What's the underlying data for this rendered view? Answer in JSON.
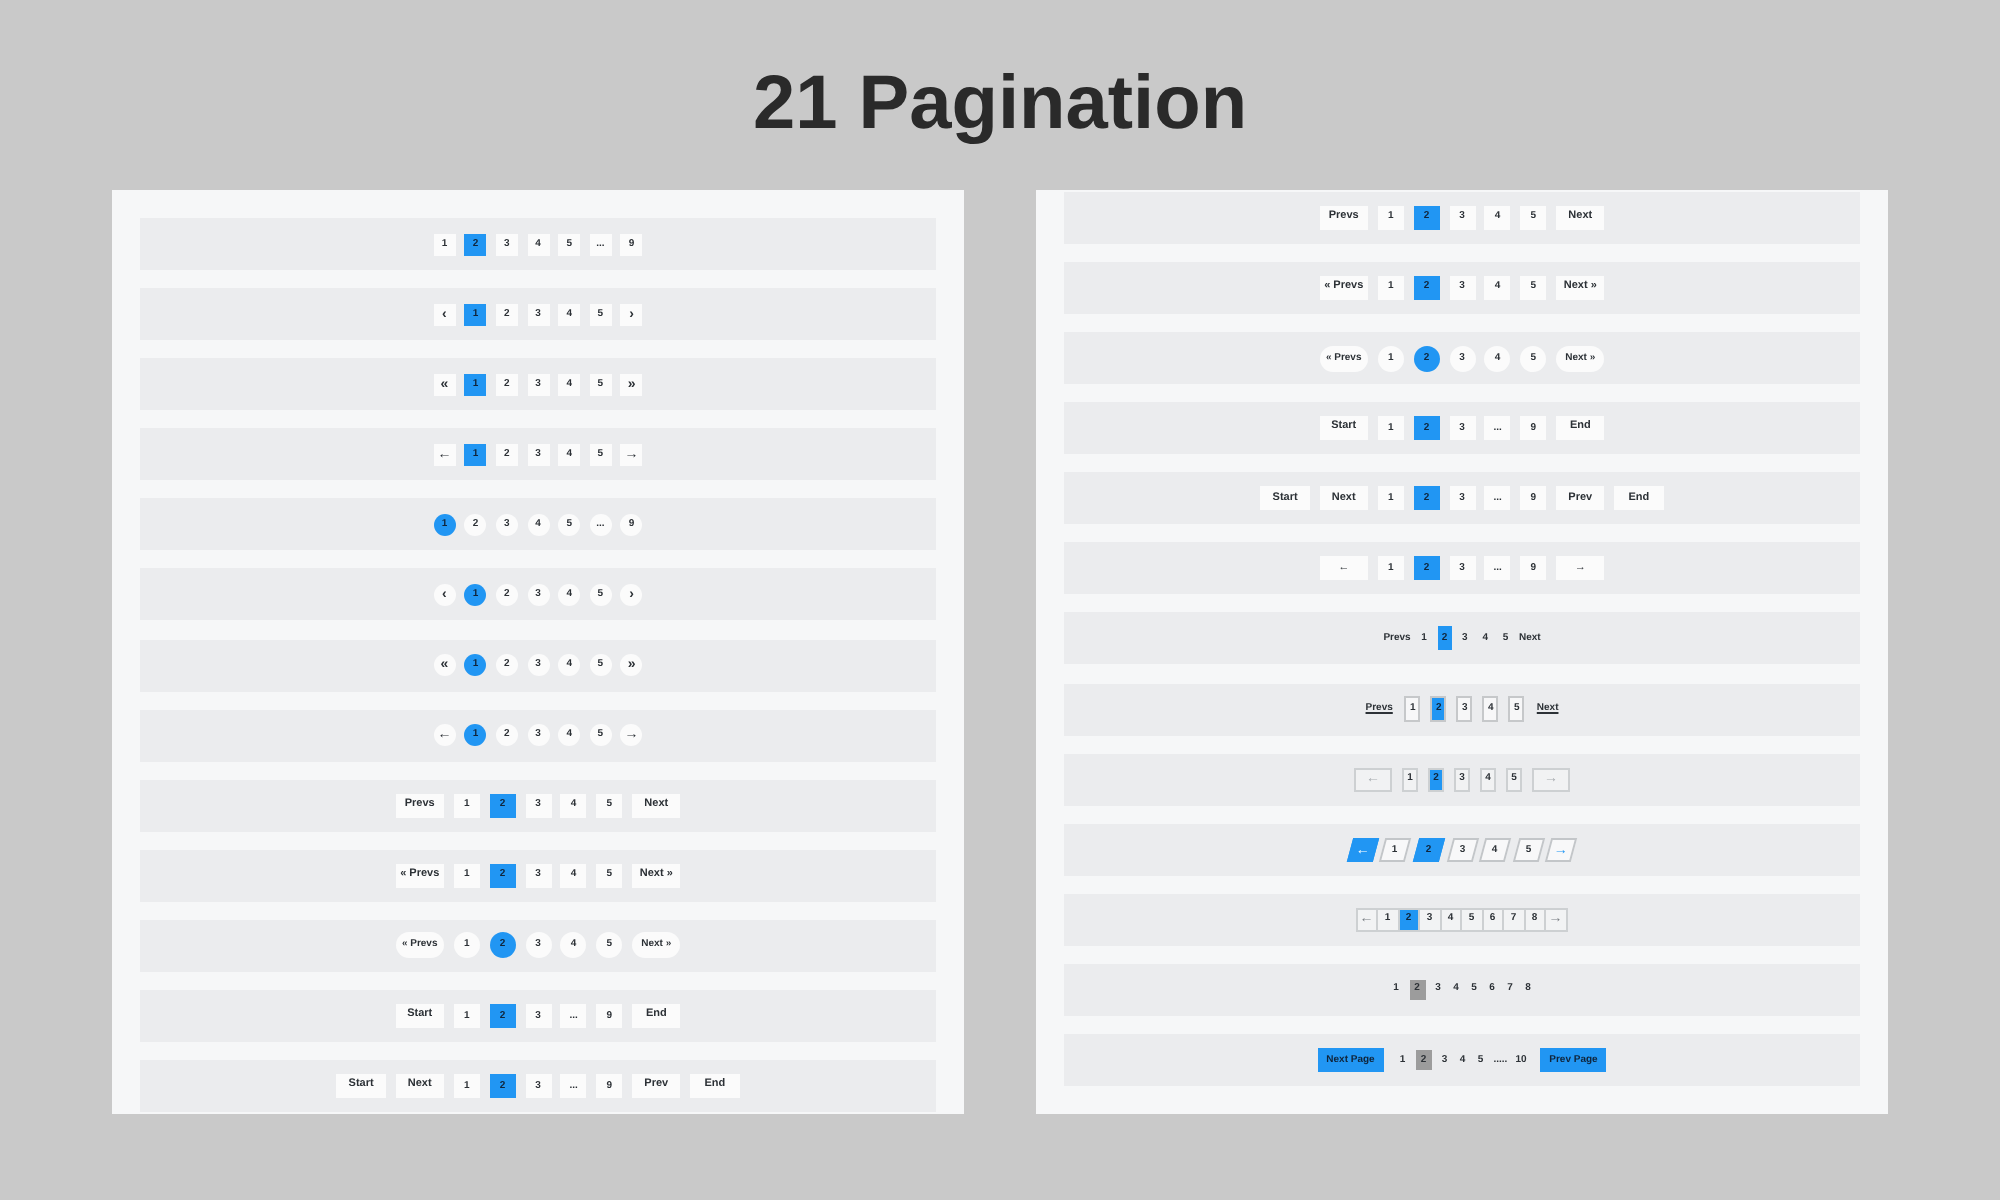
{
  "title": "21 Pagination",
  "panels": [
    {
      "rows": [
        {
          "kind": "mini",
          "items": [
            {
              "kind": "page",
              "text": "1",
              "selected": false
            },
            {
              "kind": "page",
              "text": "2",
              "selected": true
            },
            {
              "kind": "page",
              "text": "3",
              "selected": false
            },
            {
              "kind": "page",
              "text": "4",
              "selected": false
            },
            {
              "kind": "page",
              "text": "5",
              "selected": false
            },
            {
              "kind": "gap",
              "text": "...",
              "selected": false
            },
            {
              "kind": "page",
              "text": "9",
              "selected": false
            }
          ]
        },
        {
          "kind": "mini",
          "items": [
            {
              "kind": "nav",
              "text": "‹",
              "selected": false
            },
            {
              "kind": "page",
              "text": "1",
              "selected": true
            },
            {
              "kind": "page",
              "text": "2",
              "selected": false
            },
            {
              "kind": "page",
              "text": "3",
              "selected": false
            },
            {
              "kind": "page",
              "text": "4",
              "selected": false
            },
            {
              "kind": "page",
              "text": "5",
              "selected": false
            },
            {
              "kind": "nav",
              "text": "›",
              "selected": false
            }
          ]
        },
        {
          "kind": "mini",
          "items": [
            {
              "kind": "nav",
              "text": "«",
              "selected": false
            },
            {
              "kind": "page",
              "text": "1",
              "selected": true
            },
            {
              "kind": "page",
              "text": "2",
              "selected": false
            },
            {
              "kind": "page",
              "text": "3",
              "selected": false
            },
            {
              "kind": "page",
              "text": "4",
              "selected": false
            },
            {
              "kind": "page",
              "text": "5",
              "selected": false
            },
            {
              "kind": "nav",
              "text": "»",
              "selected": false
            }
          ]
        },
        {
          "kind": "mini",
          "items": [
            {
              "kind": "nav",
              "text": "←",
              "selected": false
            },
            {
              "kind": "page",
              "text": "1",
              "selected": true
            },
            {
              "kind": "page",
              "text": "2",
              "selected": false
            },
            {
              "kind": "page",
              "text": "3",
              "selected": false
            },
            {
              "kind": "page",
              "text": "4",
              "selected": false
            },
            {
              "kind": "page",
              "text": "5",
              "selected": false
            },
            {
              "kind": "nav",
              "text": "→",
              "selected": false
            }
          ]
        },
        {
          "kind": "dots",
          "items": [
            {
              "kind": "page",
              "text": "1",
              "selected": true
            },
            {
              "kind": "page",
              "text": "2",
              "selected": false
            },
            {
              "kind": "page",
              "text": "3",
              "selected": false
            },
            {
              "kind": "page",
              "text": "4",
              "selected": false
            },
            {
              "kind": "page",
              "text": "5",
              "selected": false
            },
            {
              "kind": "gap",
              "text": "...",
              "selected": false
            },
            {
              "kind": "page",
              "text": "9",
              "selected": false
            }
          ]
        },
        {
          "kind": "dots",
          "items": [
            {
              "kind": "nav",
              "text": "‹",
              "selected": false
            },
            {
              "kind": "page",
              "text": "1",
              "selected": true
            },
            {
              "kind": "page",
              "text": "2",
              "selected": false
            },
            {
              "kind": "page",
              "text": "3",
              "selected": false
            },
            {
              "kind": "page",
              "text": "4",
              "selected": false
            },
            {
              "kind": "page",
              "text": "5",
              "selected": false
            },
            {
              "kind": "nav",
              "text": "›",
              "selected": false
            }
          ]
        },
        {
          "kind": "dots",
          "items": [
            {
              "kind": "nav",
              "text": "«",
              "selected": false
            },
            {
              "kind": "page",
              "text": "1",
              "selected": true
            },
            {
              "kind": "page",
              "text": "2",
              "selected": false
            },
            {
              "kind": "page",
              "text": "3",
              "selected": false
            },
            {
              "kind": "page",
              "text": "4",
              "selected": false
            },
            {
              "kind": "page",
              "text": "5",
              "selected": false
            },
            {
              "kind": "nav",
              "text": "»",
              "selected": false
            }
          ]
        },
        {
          "kind": "dots",
          "items": [
            {
              "kind": "nav",
              "text": "←",
              "selected": false
            },
            {
              "kind": "page",
              "text": "1",
              "selected": true
            },
            {
              "kind": "page",
              "text": "2",
              "selected": false
            },
            {
              "kind": "page",
              "text": "3",
              "selected": false
            },
            {
              "kind": "page",
              "text": "4",
              "selected": false
            },
            {
              "kind": "page",
              "text": "5",
              "selected": false
            },
            {
              "kind": "nav",
              "text": "→",
              "selected": false
            }
          ]
        },
        {
          "kind": "box",
          "items": [
            {
              "kind": "nav",
              "text": "Prevs",
              "selected": false
            },
            {
              "kind": "page",
              "text": "1",
              "selected": false
            },
            {
              "kind": "page",
              "text": "2",
              "selected": true
            },
            {
              "kind": "page",
              "text": "3",
              "selected": false
            },
            {
              "kind": "page",
              "text": "4",
              "selected": false
            },
            {
              "kind": "page",
              "text": "5",
              "selected": false
            },
            {
              "kind": "nav",
              "text": "Next",
              "selected": false
            }
          ]
        },
        {
          "kind": "box",
          "items": [
            {
              "kind": "nav",
              "text": "« Prevs",
              "selected": false
            },
            {
              "kind": "page",
              "text": "1",
              "selected": false
            },
            {
              "kind": "page",
              "text": "2",
              "selected": true
            },
            {
              "kind": "page",
              "text": "3",
              "selected": false
            },
            {
              "kind": "page",
              "text": "4",
              "selected": false
            },
            {
              "kind": "page",
              "text": "5",
              "selected": false
            },
            {
              "kind": "nav",
              "text": "Next »",
              "selected": false
            }
          ]
        },
        {
          "kind": "round",
          "items": [
            {
              "kind": "nav",
              "text": "« Prevs",
              "selected": false
            },
            {
              "kind": "page",
              "text": "1",
              "selected": false
            },
            {
              "kind": "page",
              "text": "2",
              "selected": true
            },
            {
              "kind": "page",
              "text": "3",
              "selected": false
            },
            {
              "kind": "page",
              "text": "4",
              "selected": false
            },
            {
              "kind": "page",
              "text": "5",
              "selected": false
            },
            {
              "kind": "nav",
              "text": "Next »",
              "selected": false
            }
          ]
        },
        {
          "kind": "box",
          "items": [
            {
              "kind": "nav",
              "text": "Start",
              "selected": false
            },
            {
              "kind": "page",
              "text": "1",
              "selected": false
            },
            {
              "kind": "page",
              "text": "2",
              "selected": true
            },
            {
              "kind": "page",
              "text": "3",
              "selected": false
            },
            {
              "kind": "gap",
              "text": "...",
              "selected": false
            },
            {
              "kind": "page",
              "text": "9",
              "selected": false
            },
            {
              "kind": "nav",
              "text": "End",
              "selected": false
            }
          ]
        },
        {
          "kind": "box",
          "items": [
            {
              "kind": "nav",
              "text": "Start",
              "selected": false
            },
            {
              "kind": "nav",
              "text": "Next",
              "selected": false
            },
            {
              "kind": "page",
              "text": "1",
              "selected": false
            },
            {
              "kind": "page",
              "text": "2",
              "selected": true
            },
            {
              "kind": "page",
              "text": "3",
              "selected": false
            },
            {
              "kind": "gap",
              "text": "...",
              "selected": false
            },
            {
              "kind": "page",
              "text": "9",
              "selected": false
            },
            {
              "kind": "nav",
              "text": "Prev",
              "selected": false
            },
            {
              "kind": "nav",
              "text": "End",
              "selected": false
            }
          ]
        }
      ]
    },
    {
      "rows": [
        {
          "kind": "box",
          "items": [
            {
              "kind": "nav",
              "text": "Prevs",
              "selected": false
            },
            {
              "kind": "page",
              "text": "1",
              "selected": false
            },
            {
              "kind": "page",
              "text": "2",
              "selected": true
            },
            {
              "kind": "page",
              "text": "3",
              "selected": false
            },
            {
              "kind": "page",
              "text": "4",
              "selected": false
            },
            {
              "kind": "page",
              "text": "5",
              "selected": false
            },
            {
              "kind": "nav",
              "text": "Next",
              "selected": false
            }
          ]
        },
        {
          "kind": "box",
          "items": [
            {
              "kind": "nav",
              "text": "« Prevs",
              "selected": false
            },
            {
              "kind": "page",
              "text": "1",
              "selected": false
            },
            {
              "kind": "page",
              "text": "2",
              "selected": true
            },
            {
              "kind": "page",
              "text": "3",
              "selected": false
            },
            {
              "kind": "page",
              "text": "4",
              "selected": false
            },
            {
              "kind": "page",
              "text": "5",
              "selected": false
            },
            {
              "kind": "nav",
              "text": "Next »",
              "selected": false
            }
          ]
        },
        {
          "kind": "round",
          "items": [
            {
              "kind": "nav",
              "text": "« Prevs",
              "selected": false
            },
            {
              "kind": "page",
              "text": "1",
              "selected": false
            },
            {
              "kind": "page",
              "text": "2",
              "selected": true
            },
            {
              "kind": "page",
              "text": "3",
              "selected": false
            },
            {
              "kind": "page",
              "text": "4",
              "selected": false
            },
            {
              "kind": "page",
              "text": "5",
              "selected": false
            },
            {
              "kind": "nav",
              "text": "Next »",
              "selected": false
            }
          ]
        },
        {
          "kind": "box",
          "items": [
            {
              "kind": "nav",
              "text": "Start",
              "selected": false
            },
            {
              "kind": "page",
              "text": "1",
              "selected": false
            },
            {
              "kind": "page",
              "text": "2",
              "selected": true
            },
            {
              "kind": "page",
              "text": "3",
              "selected": false
            },
            {
              "kind": "gap",
              "text": "...",
              "selected": false
            },
            {
              "kind": "page",
              "text": "9",
              "selected": false
            },
            {
              "kind": "nav",
              "text": "End",
              "selected": false
            }
          ]
        },
        {
          "kind": "box",
          "items": [
            {
              "kind": "nav",
              "text": "Start",
              "selected": false
            },
            {
              "kind": "nav",
              "text": "Next",
              "selected": false
            },
            {
              "kind": "page",
              "text": "1",
              "selected": false
            },
            {
              "kind": "page",
              "text": "2",
              "selected": true
            },
            {
              "kind": "page",
              "text": "3",
              "selected": false
            },
            {
              "kind": "gap",
              "text": "...",
              "selected": false
            },
            {
              "kind": "page",
              "text": "9",
              "selected": false
            },
            {
              "kind": "nav",
              "text": "Prev",
              "selected": false
            },
            {
              "kind": "nav",
              "text": "End",
              "selected": false
            }
          ]
        },
        {
          "kind": "box",
          "items": [
            {
              "kind": "nav",
              "text": "←",
              "selected": false
            },
            {
              "kind": "page",
              "text": "1",
              "selected": false
            },
            {
              "kind": "page",
              "text": "2",
              "selected": true
            },
            {
              "kind": "page",
              "text": "3",
              "selected": false
            },
            {
              "kind": "gap",
              "text": "...",
              "selected": false
            },
            {
              "kind": "page",
              "text": "9",
              "selected": false
            },
            {
              "kind": "nav",
              "text": "→",
              "selected": false
            }
          ]
        },
        {
          "kind": "plain",
          "items": [
            {
              "kind": "nav",
              "text": "Prevs",
              "selected": false
            },
            {
              "kind": "page",
              "text": "1",
              "selected": false
            },
            {
              "kind": "page",
              "text": "2",
              "selected": true
            },
            {
              "kind": "page",
              "text": "3",
              "selected": false
            },
            {
              "kind": "page",
              "text": "4",
              "selected": false
            },
            {
              "kind": "page",
              "text": "5",
              "selected": false
            },
            {
              "kind": "nav",
              "text": "Next",
              "selected": false
            }
          ]
        },
        {
          "kind": "underlined",
          "items": [
            {
              "kind": "nav",
              "text": "Prevs",
              "selected": false
            },
            {
              "kind": "page",
              "text": "1",
              "selected": false
            },
            {
              "kind": "page",
              "text": "2",
              "selected": true
            },
            {
              "kind": "page",
              "text": "3",
              "selected": false
            },
            {
              "kind": "page",
              "text": "4",
              "selected": false
            },
            {
              "kind": "page",
              "text": "5",
              "selected": false
            },
            {
              "kind": "nav",
              "text": "Next",
              "selected": false
            }
          ]
        },
        {
          "kind": "outlined",
          "items": [
            {
              "kind": "nav",
              "text": "←",
              "selected": false
            },
            {
              "kind": "page",
              "text": "1",
              "selected": false
            },
            {
              "kind": "page",
              "text": "2",
              "selected": true
            },
            {
              "kind": "page",
              "text": "3",
              "selected": false
            },
            {
              "kind": "page",
              "text": "4",
              "selected": false
            },
            {
              "kind": "page",
              "text": "5",
              "selected": false
            },
            {
              "kind": "nav",
              "text": "→",
              "selected": false
            }
          ]
        },
        {
          "kind": "skewed",
          "items": [
            {
              "kind": "primary",
              "text": "←",
              "selected": false
            },
            {
              "kind": "page",
              "text": "1",
              "selected": false
            },
            {
              "kind": "page",
              "text": "2",
              "selected": true
            },
            {
              "kind": "page",
              "text": "3",
              "selected": false
            },
            {
              "kind": "page",
              "text": "4",
              "selected": false
            },
            {
              "kind": "page",
              "text": "5",
              "selected": false
            },
            {
              "kind": "nav",
              "text": "→",
              "selected": false
            }
          ]
        },
        {
          "kind": "joined",
          "items": [
            {
              "kind": "nav",
              "text": "←",
              "selected": false
            },
            {
              "kind": "page",
              "text": "1",
              "selected": false
            },
            {
              "kind": "page",
              "text": "2",
              "selected": true
            },
            {
              "kind": "page",
              "text": "3",
              "selected": false
            },
            {
              "kind": "page",
              "text": "4",
              "selected": false
            },
            {
              "kind": "page",
              "text": "5",
              "selected": false
            },
            {
              "kind": "page",
              "text": "6",
              "selected": false
            },
            {
              "kind": "page",
              "text": "7",
              "selected": false
            },
            {
              "kind": "page",
              "text": "8",
              "selected": false
            },
            {
              "kind": "nav",
              "text": "→",
              "selected": false
            }
          ]
        },
        {
          "kind": "minimal",
          "items": [
            {
              "kind": "page",
              "text": "1",
              "selected": false
            },
            {
              "kind": "page",
              "text": "2",
              "selected": true
            },
            {
              "kind": "page",
              "text": "3",
              "selected": false
            },
            {
              "kind": "page",
              "text": "4",
              "selected": false
            },
            {
              "kind": "page",
              "text": "5",
              "selected": false
            },
            {
              "kind": "page",
              "text": "6",
              "selected": false
            },
            {
              "kind": "page",
              "text": "7",
              "selected": false
            },
            {
              "kind": "page",
              "text": "8",
              "selected": false
            }
          ]
        },
        {
          "kind": "minimal",
          "items": [
            {
              "kind": "primary",
              "text": "Next Page",
              "selected": false
            },
            {
              "kind": "page",
              "text": "1",
              "selected": false
            },
            {
              "kind": "page",
              "text": "2",
              "selected": true
            },
            {
              "kind": "page",
              "text": "3",
              "selected": false
            },
            {
              "kind": "page",
              "text": "4",
              "selected": false
            },
            {
              "kind": "page",
              "text": "5",
              "selected": false
            },
            {
              "kind": "gap",
              "text": ".....",
              "selected": false
            },
            {
              "kind": "page",
              "text": "10",
              "selected": false
            },
            {
              "kind": "primary",
              "text": "Prev Page",
              "selected": false
            }
          ]
        }
      ]
    }
  ]
}
